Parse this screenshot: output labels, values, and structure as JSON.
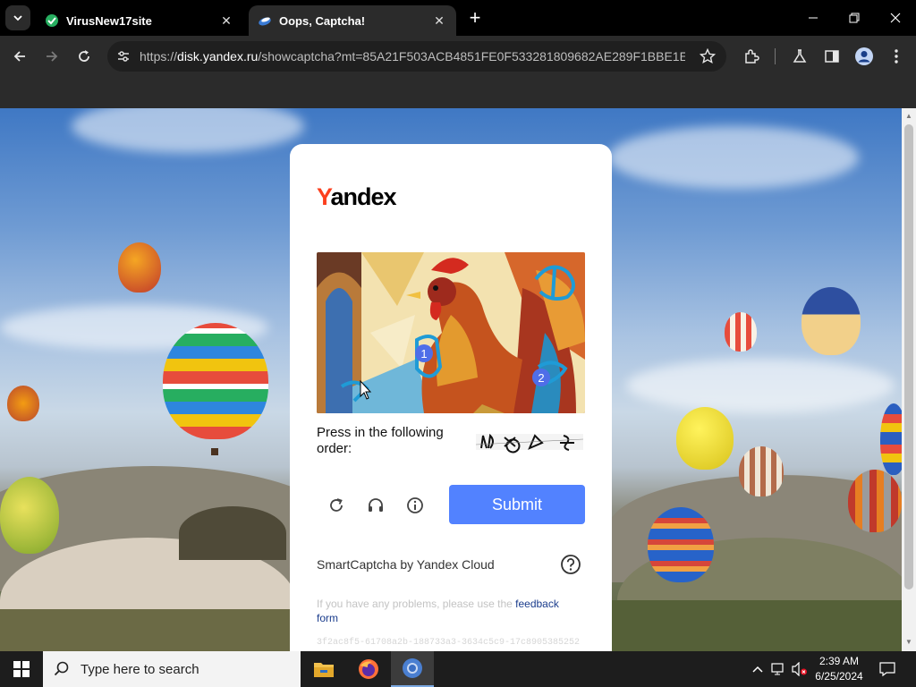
{
  "browser": {
    "tabs": [
      {
        "title": "VirusNew17site",
        "active": false
      },
      {
        "title": "Oops, Captcha!",
        "active": true
      }
    ],
    "new_tab_label": "+",
    "url_scheme": "https://",
    "url_host": "disk.yandex.ru",
    "url_rest": "/showcaptcha?mt=85A21F503ACB4851FE0F533281809682AE289F1BBE1E70..."
  },
  "captcha": {
    "logo_first": "Y",
    "logo_rest": "andex",
    "image_markers": [
      "1",
      "2"
    ],
    "instruction": "Press in the following order:",
    "submit_label": "Submit",
    "branding": "SmartCaptcha by Yandex Cloud",
    "problems_text": "If you have any problems, please use the ",
    "feedback_link": "feedback form",
    "request_id": "3f2ac8f5-61708a2b-188733a3-3634c5c9-17c8905385252"
  },
  "taskbar": {
    "search_placeholder": "Type here to search",
    "time": "2:39 AM",
    "date": "6/25/2024"
  },
  "colors": {
    "yandex_red": "#fc3f1d",
    "submit_blue": "#5282ff",
    "chrome_dark": "#2b2b2b"
  },
  "icons": [
    "tab-list-icon",
    "back-icon",
    "forward-icon",
    "reload-icon",
    "site-settings-icon",
    "star-icon",
    "extensions-icon",
    "labs-icon",
    "side-panel-icon",
    "profile-icon",
    "menu-icon",
    "refresh-icon",
    "audio-icon",
    "info-icon",
    "help-icon",
    "windows-icon",
    "search-icon",
    "file-explorer-icon",
    "firefox-icon",
    "chrome-icon"
  ]
}
